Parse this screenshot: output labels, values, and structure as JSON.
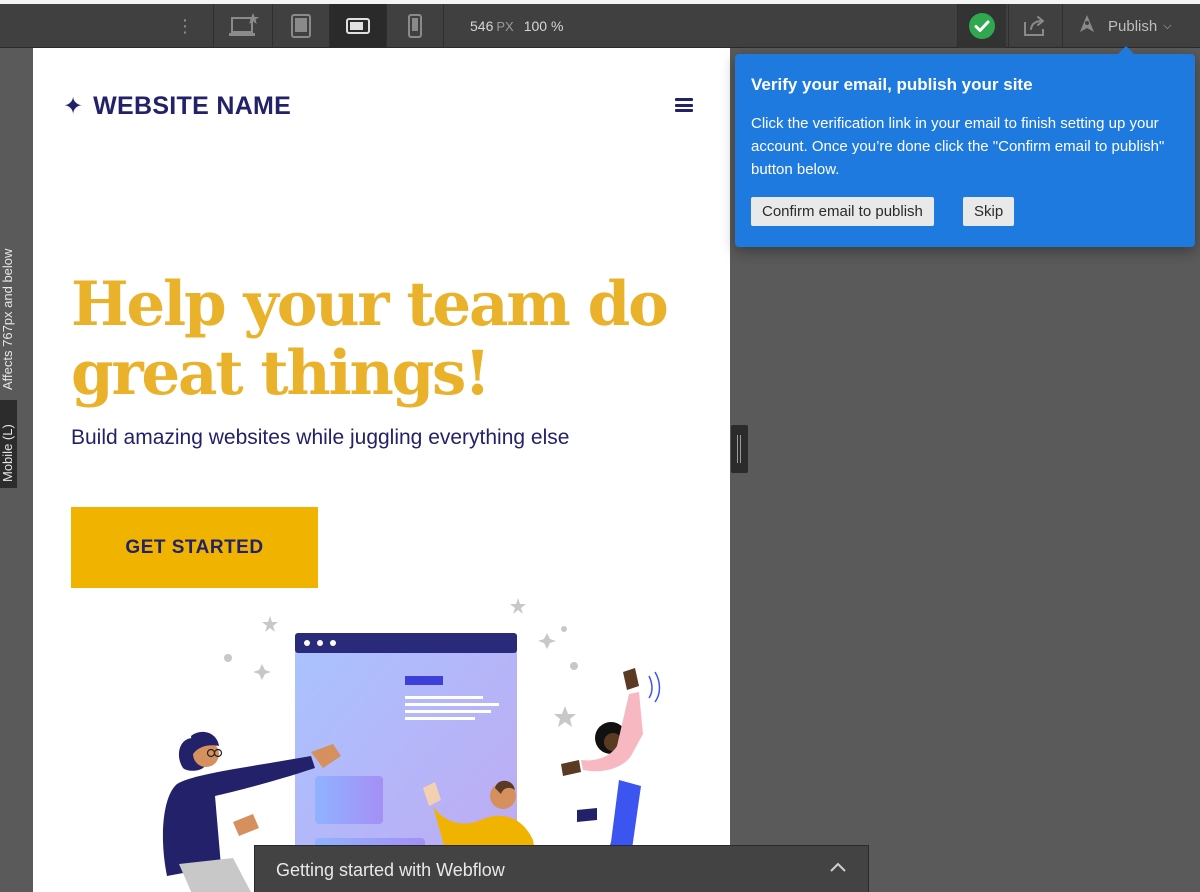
{
  "toolbar": {
    "size_value": "546",
    "size_unit": "PX",
    "zoom": "100 %",
    "publish_label": "Publish"
  },
  "left_strip": {
    "affects_label": "Affects 767px and below",
    "breakpoint_label": "Mobile (L)"
  },
  "site": {
    "brand_name": "WEBSITE NAME",
    "hero_title": "Help your team do great things!",
    "hero_subtitle": "Build amazing websites while juggling everything else",
    "cta_label": "GET STARTED"
  },
  "popover": {
    "title": "Verify your email, publish your site",
    "body": "Click the verification link in your email to finish setting up your account. Once you’re done click the \"Confirm email to publish\" button below.",
    "confirm_label": "Confirm email to publish",
    "skip_label": "Skip"
  },
  "bottom_panel": {
    "title": "Getting started with Webflow"
  },
  "icons": {
    "desktop_star": "desktop-star-icon",
    "tablet": "tablet-icon",
    "mobile_landscape": "mobile-landscape-icon",
    "mobile_portrait": "mobile-portrait-icon",
    "check": "check-circle-icon",
    "share": "share-icon",
    "rocket": "rocket-icon"
  },
  "colors": {
    "accent_blue": "#1f7ae0",
    "brand_navy": "#22216a",
    "hero_yellow": "#eab12b",
    "cta_yellow": "#f0b400",
    "check_green": "#2fa84f"
  }
}
